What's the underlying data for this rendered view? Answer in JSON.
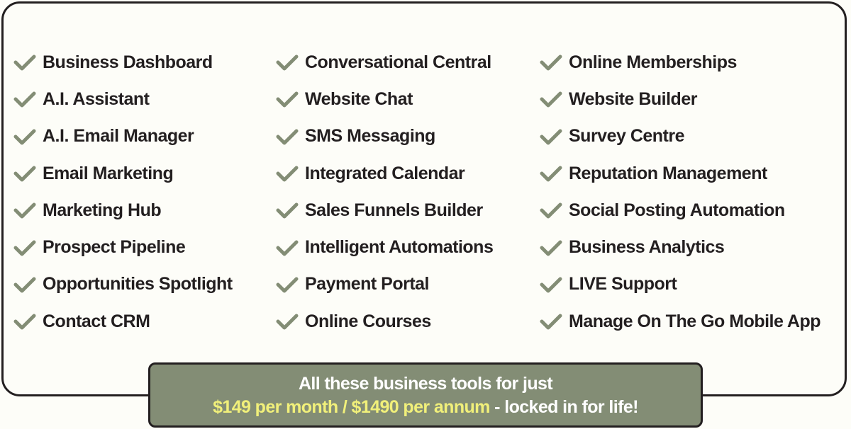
{
  "columns": [
    [
      "Business Dashboard",
      "A.I. Assistant",
      "A.I. Email Manager",
      "Email Marketing",
      "Marketing Hub",
      "Prospect Pipeline",
      "Opportunities Spotlight",
      "Contact CRM"
    ],
    [
      "Conversational Central",
      "Website Chat",
      "SMS Messaging",
      "Integrated Calendar",
      "Sales Funnels Builder",
      "Intelligent Automations",
      "Payment Portal",
      "Online Courses"
    ],
    [
      "Online Memberships",
      "Website Builder",
      "Survey Centre",
      "Reputation Management",
      "Social Posting Automation",
      "Business Analytics",
      "LIVE Support",
      "Manage On The Go Mobile App"
    ]
  ],
  "banner": {
    "line1": "All these business tools for just",
    "price": "$149 per month / $1490 per annum",
    "suffix": " - locked in for life!"
  },
  "colors": {
    "check": "#838d75",
    "banner_bg": "#838d75",
    "price": "#f1f07a"
  }
}
